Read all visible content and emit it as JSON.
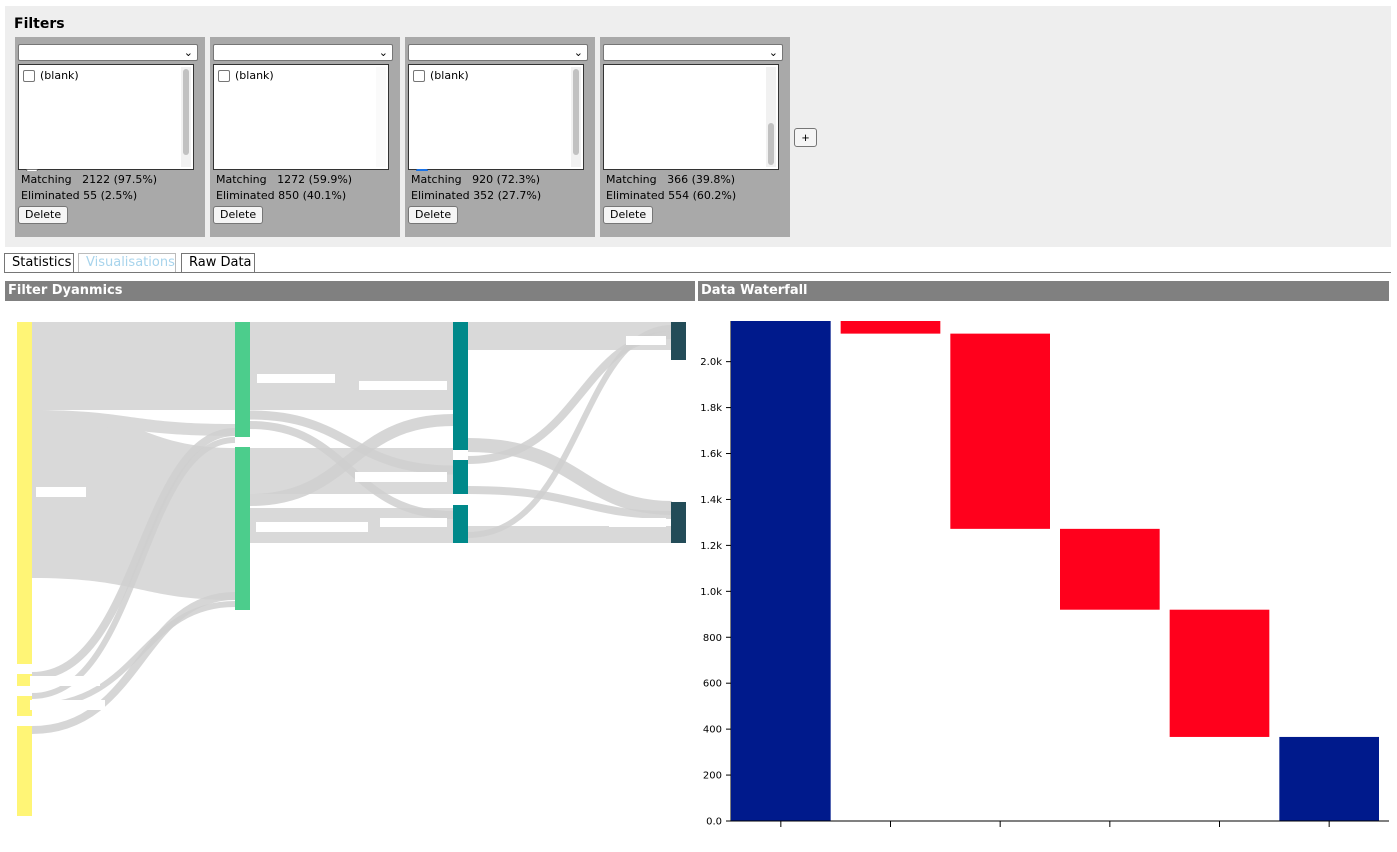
{
  "filters": {
    "title": "Filters",
    "boxes": [
      {
        "option_label": "(blank)",
        "option_checked": false,
        "matching_label": "Matching",
        "matching_value": "2122 (97.5%)",
        "eliminated_label": "Eliminated",
        "eliminated_value": "55 (2.5%)",
        "delete_label": "Delete"
      },
      {
        "option_label": "(blank)",
        "option_checked": false,
        "matching_label": "Matching",
        "matching_value": "1272 (59.9%)",
        "eliminated_label": "Eliminated",
        "eliminated_value": "850 (40.1%)",
        "delete_label": "Delete"
      },
      {
        "option_label": "(blank)",
        "option_checked": false,
        "matching_label": "Matching",
        "matching_value": "920 (72.3%)",
        "eliminated_label": "Eliminated",
        "eliminated_value": "352 (27.7%)",
        "delete_label": "Delete"
      },
      {
        "option_label": "",
        "option_checked": false,
        "matching_label": "Matching",
        "matching_value": "366 (39.8%)",
        "eliminated_label": "Eliminated",
        "eliminated_value": "554 (60.2%)",
        "delete_label": "Delete"
      }
    ],
    "add_label": "+"
  },
  "tabs": [
    {
      "label": "Statistics",
      "active": false
    },
    {
      "label": "Visualisations",
      "active": true
    },
    {
      "label": "Raw Data",
      "active": false
    }
  ],
  "panels": {
    "filter_dynamics_title": "Filter Dyanmics",
    "waterfall_title": "Data Waterfall"
  },
  "colors": {
    "stage1": "#fff576",
    "stage2": "#4ccd8c",
    "stage3": "#00898a",
    "stage4": "#234c58",
    "link": "#d9d9d9",
    "total": "#001a8c",
    "decrease": "#ff001c"
  },
  "chart_data": {
    "type": "bar",
    "subtype": "waterfall",
    "title": "Data Waterfall",
    "xlabel": "",
    "ylabel": "",
    "ylim": [
      0,
      2177
    ],
    "y_ticks": [
      0,
      200,
      400,
      600,
      800,
      1000,
      1200,
      1400,
      1600,
      1800,
      2000
    ],
    "y_tick_labels": [
      "0.0",
      "200",
      "400",
      "600",
      "800",
      "1.0k",
      "1.2k",
      "1.4k",
      "1.6k",
      "1.8k",
      "2.0k"
    ],
    "bars": [
      {
        "kind": "total",
        "start": 0,
        "end": 2177
      },
      {
        "kind": "decrease",
        "start": 2177,
        "end": 2122
      },
      {
        "kind": "decrease",
        "start": 2122,
        "end": 1272
      },
      {
        "kind": "decrease",
        "start": 1272,
        "end": 920
      },
      {
        "kind": "decrease",
        "start": 920,
        "end": 366
      },
      {
        "kind": "total",
        "start": 0,
        "end": 366
      }
    ],
    "grid": false
  }
}
